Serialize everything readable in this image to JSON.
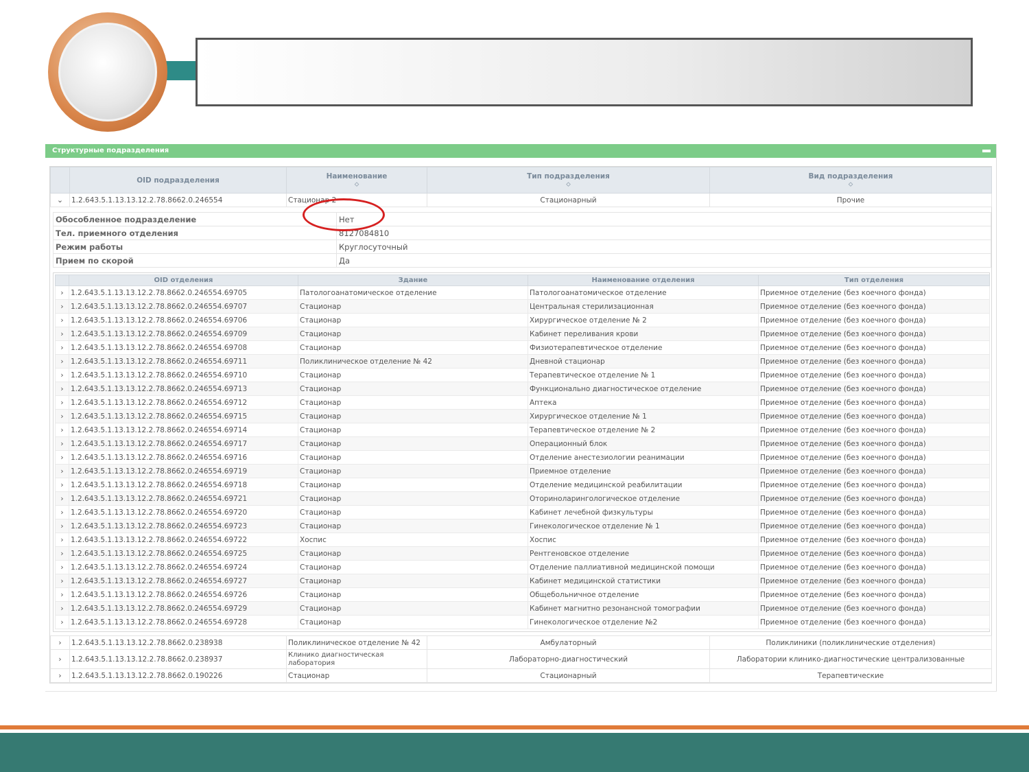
{
  "panel": {
    "title": "Структурные подразделения"
  },
  "outer_table": {
    "headers": [
      "OID подразделения",
      "Наименование",
      "Тип подразделения",
      "Вид подразделения"
    ],
    "expanded_row": {
      "oid": "1.2.643.5.1.13.13.12.2.78.8662.0.246554",
      "name": "Стационар 2",
      "type": "Стационарный",
      "kind": "Прочие"
    },
    "collapsed_rows": [
      {
        "oid": "1.2.643.5.1.13.13.12.2.78.8662.0.238938",
        "name": "Поликлиническое отделение № 42",
        "type": "Амбулаторный",
        "kind": "Поликлиники (поликлинические отделения)"
      },
      {
        "oid": "1.2.643.5.1.13.13.12.2.78.8662.0.238937",
        "name": "Клинико диагностическая лаборатория",
        "type": "Лабораторно-диагностический",
        "kind": "Лаборатории клинико-диагностические централизованные"
      },
      {
        "oid": "1.2.643.5.1.13.13.12.2.78.8662.0.190226",
        "name": "Стационар",
        "type": "Стационарный",
        "kind": "Терапевтические"
      }
    ]
  },
  "details": [
    {
      "key": "Обособленное подразделение",
      "value": "Нет"
    },
    {
      "key": "Тел. приемного отделения",
      "value": "8127084810"
    },
    {
      "key": "Режим работы",
      "value": "Круглосуточный"
    },
    {
      "key": "Прием по скорой",
      "value": "Да"
    }
  ],
  "departments": {
    "headers": [
      "OID отделения",
      "Здание",
      "Наименование отделения",
      "Тип отделения"
    ],
    "rows": [
      {
        "oid": "1.2.643.5.1.13.13.12.2.78.8662.0.246554.69705",
        "building": "Патологоанатомическое отделение",
        "name": "Патологоанатомическое отделение",
        "type": "Приемное отделение (без коечного фонда)"
      },
      {
        "oid": "1.2.643.5.1.13.13.12.2.78.8662.0.246554.69707",
        "building": "Стационар",
        "name": "Центральная стерилизационная",
        "type": "Приемное отделение (без коечного фонда)"
      },
      {
        "oid": "1.2.643.5.1.13.13.12.2.78.8662.0.246554.69706",
        "building": "Стационар",
        "name": "Хирургическое отделение № 2",
        "type": "Приемное отделение (без коечного фонда)"
      },
      {
        "oid": "1.2.643.5.1.13.13.12.2.78.8662.0.246554.69709",
        "building": "Стационар",
        "name": "Кабинет переливания крови",
        "type": "Приемное отделение (без коечного фонда)"
      },
      {
        "oid": "1.2.643.5.1.13.13.12.2.78.8662.0.246554.69708",
        "building": "Стационар",
        "name": "Физиотерапевтическое отделение",
        "type": "Приемное отделение (без коечного фонда)"
      },
      {
        "oid": "1.2.643.5.1.13.13.12.2.78.8662.0.246554.69711",
        "building": "Поликлиническое отделение № 42",
        "name": "Дневной стационар",
        "type": "Приемное отделение (без коечного фонда)"
      },
      {
        "oid": "1.2.643.5.1.13.13.12.2.78.8662.0.246554.69710",
        "building": "Стационар",
        "name": "Терапевтическое отделение № 1",
        "type": "Приемное отделение (без коечного фонда)"
      },
      {
        "oid": "1.2.643.5.1.13.13.12.2.78.8662.0.246554.69713",
        "building": "Стационар",
        "name": "Функционально диагностическое отделение",
        "type": "Приемное отделение (без коечного фонда)"
      },
      {
        "oid": "1.2.643.5.1.13.13.12.2.78.8662.0.246554.69712",
        "building": "Стационар",
        "name": "Аптека",
        "type": "Приемное отделение (без коечного фонда)"
      },
      {
        "oid": "1.2.643.5.1.13.13.12.2.78.8662.0.246554.69715",
        "building": "Стационар",
        "name": "Хирургическое отделение № 1",
        "type": "Приемное отделение (без коечного фонда)"
      },
      {
        "oid": "1.2.643.5.1.13.13.12.2.78.8662.0.246554.69714",
        "building": "Стационар",
        "name": "Терапевтическое отделение № 2",
        "type": "Приемное отделение (без коечного фонда)"
      },
      {
        "oid": "1.2.643.5.1.13.13.12.2.78.8662.0.246554.69717",
        "building": "Стационар",
        "name": "Операционный блок",
        "type": "Приемное отделение (без коечного фонда)"
      },
      {
        "oid": "1.2.643.5.1.13.13.12.2.78.8662.0.246554.69716",
        "building": "Стационар",
        "name": "Отделение анестезиологии реанимации",
        "type": "Приемное отделение (без коечного фонда)"
      },
      {
        "oid": "1.2.643.5.1.13.13.12.2.78.8662.0.246554.69719",
        "building": "Стационар",
        "name": "Приемное отделение",
        "type": "Приемное отделение (без коечного фонда)"
      },
      {
        "oid": "1.2.643.5.1.13.13.12.2.78.8662.0.246554.69718",
        "building": "Стационар",
        "name": "Отделение медицинской реабилитации",
        "type": "Приемное отделение (без коечного фонда)"
      },
      {
        "oid": "1.2.643.5.1.13.13.12.2.78.8662.0.246554.69721",
        "building": "Стационар",
        "name": "Оториноларингологическое отделение",
        "type": "Приемное отделение (без коечного фонда)"
      },
      {
        "oid": "1.2.643.5.1.13.13.12.2.78.8662.0.246554.69720",
        "building": "Стационар",
        "name": "Кабинет лечебной физкультуры",
        "type": "Приемное отделение (без коечного фонда)"
      },
      {
        "oid": "1.2.643.5.1.13.13.12.2.78.8662.0.246554.69723",
        "building": "Стационар",
        "name": "Гинекологическое отделение № 1",
        "type": "Приемное отделение (без коечного фонда)"
      },
      {
        "oid": "1.2.643.5.1.13.13.12.2.78.8662.0.246554.69722",
        "building": "Хоспис",
        "name": "Хоспис",
        "type": "Приемное отделение (без коечного фонда)"
      },
      {
        "oid": "1.2.643.5.1.13.13.12.2.78.8662.0.246554.69725",
        "building": "Стационар",
        "name": "Рентгеновское отделение",
        "type": "Приемное отделение (без коечного фонда)"
      },
      {
        "oid": "1.2.643.5.1.13.13.12.2.78.8662.0.246554.69724",
        "building": "Стационар",
        "name": "Отделение паллиативной медицинской помощи",
        "type": "Приемное отделение (без коечного фонда)"
      },
      {
        "oid": "1.2.643.5.1.13.13.12.2.78.8662.0.246554.69727",
        "building": "Стационар",
        "name": "Кабинет медицинской статистики",
        "type": "Приемное отделение (без коечного фонда)"
      },
      {
        "oid": "1.2.643.5.1.13.13.12.2.78.8662.0.246554.69726",
        "building": "Стационар",
        "name": "Общебольничное отделение",
        "type": "Приемное отделение (без коечного фонда)"
      },
      {
        "oid": "1.2.643.5.1.13.13.12.2.78.8662.0.246554.69729",
        "building": "Стационар",
        "name": "Кабинет магнитно резонансной томографии",
        "type": "Приемное отделение (без коечного фонда)"
      },
      {
        "oid": "1.2.643.5.1.13.13.12.2.78.8662.0.246554.69728",
        "building": "Стационар",
        "name": "Гинекологическое отделение №2",
        "type": "Приемное отделение (без коечного фонда)"
      }
    ]
  },
  "icons": {
    "expand": "chevron-right-icon",
    "collapse": "chevron-down-icon",
    "sort": "sort-icon",
    "panel_collapse": "minus-icon"
  },
  "colors": {
    "panel_header": "#7ccc88",
    "highlight": "#d62020",
    "footer_band": "#367a72",
    "footer_line": "#e07b39"
  }
}
